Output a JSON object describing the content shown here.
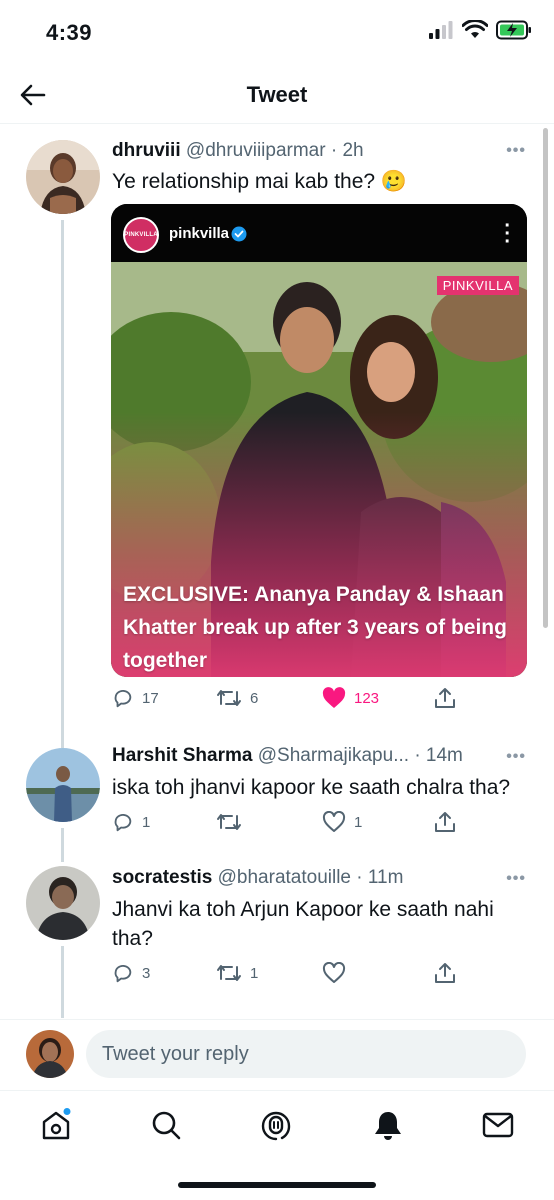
{
  "status_bar": {
    "time": "4:39"
  },
  "header": {
    "title": "Tweet"
  },
  "main_tweet": {
    "name": "dhruviii",
    "handle": "@dhruviiiparmar",
    "time": "2h",
    "text": "Ye relationship mai kab the? 🥲",
    "media": {
      "account": "pinkvilla",
      "logo_text": "PINKVILLA",
      "badge": "PINKVILLA",
      "headline": "EXCLUSIVE: Ananya Panday & Ishaan Khatter break up after 3 years of being together"
    },
    "replies": "17",
    "retweets": "6",
    "likes": "123",
    "liked": true
  },
  "replies": [
    {
      "name": "Harshit Sharma",
      "handle": "@Sharmajikapu...",
      "time": "14m",
      "text": "iska toh jhanvi kapoor ke saath chalra tha?",
      "replies": "1",
      "retweets": "",
      "likes": "1"
    },
    {
      "name": "socratestis",
      "handle": "@bharatatouille",
      "time": "11m",
      "text": "Jhanvi ka toh Arjun Kapoor ke saath nahi tha?",
      "replies": "3",
      "retweets": "1",
      "likes": ""
    }
  ],
  "reply_bar": {
    "placeholder": "Tweet your reply"
  },
  "colors": {
    "like_pink": "#f91880",
    "muted": "#536471",
    "verified_blue": "#1d9bf0",
    "brand_pink": "#e4336f"
  },
  "tab_bar": {
    "icons": [
      "home-icon",
      "search-icon",
      "spaces-icon",
      "notifications-icon",
      "messages-icon"
    ]
  }
}
